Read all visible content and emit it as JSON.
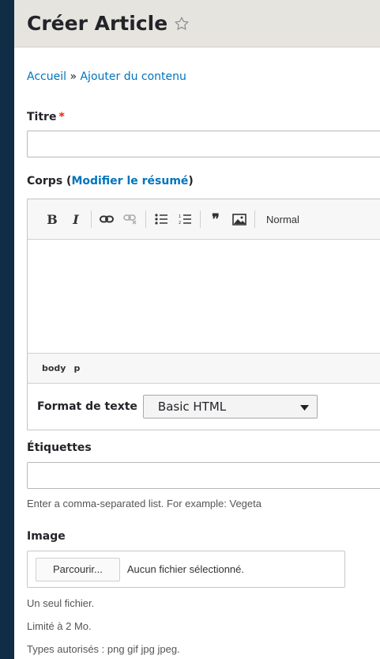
{
  "header": {
    "title": "Créer Article"
  },
  "breadcrumb": {
    "home": "Accueil",
    "separator": "»",
    "current": "Ajouter du contenu"
  },
  "fields": {
    "title": {
      "label": "Titre",
      "required_mark": "*",
      "value": ""
    },
    "body": {
      "label_prefix": "Corps (",
      "summary_link": "Modifier le résumé",
      "label_suffix": ")",
      "toolbar": {
        "bold": "B",
        "italic": "I",
        "blockquote": "❞",
        "format": "Normal"
      },
      "path": [
        "body",
        "p"
      ],
      "text_format_label": "Format de texte",
      "text_format_value": "Basic HTML"
    },
    "tags": {
      "label": "Étiquettes",
      "value": "",
      "description": "Enter a comma-separated list. For example: Vegeta"
    },
    "image": {
      "label": "Image",
      "browse_button": "Parcourir...",
      "file_status": "Aucun fichier sélectionné.",
      "help": [
        "Un seul fichier.",
        "Limité à 2 Mo.",
        "Types autorisés : png gif jpg jpeg."
      ]
    }
  },
  "icons": {
    "favorite": "star-outline-icon",
    "link": "link-icon",
    "unlink": "unlink-icon",
    "bullet_list": "bulleted-list-icon",
    "numbered_list": "numbered-list-icon",
    "blockquote": "blockquote-icon",
    "image": "image-icon",
    "dropdown": "chevron-down-icon"
  },
  "colors": {
    "link": "#0074bd",
    "required": "#e32700",
    "header_bg": "#e6e4df",
    "frame": "#0f2d44"
  }
}
